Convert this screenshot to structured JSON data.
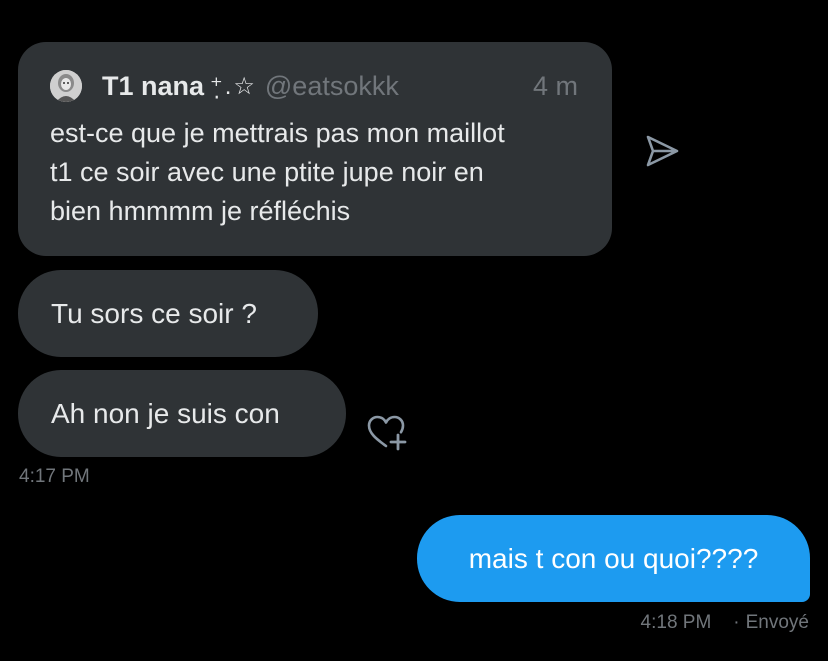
{
  "quoted_tweet": {
    "author_name": "T1 nana",
    "author_emoji": "⁺̣.☆",
    "handle": "@eatsokkk",
    "time": "4 m",
    "text": "est-ce que je mettrais pas mon maillot\nt1 ce soir avec une ptite jupe noir en\nbien hmmmm je réfléchis",
    "share_icon": "send-icon"
  },
  "messages": [
    {
      "text": "Tu sors ce soir ?",
      "direction": "received"
    },
    {
      "text": "Ah non je suis con",
      "direction": "received"
    }
  ],
  "received_time": "4:17 PM",
  "react_icon": "heart-plus-icon",
  "sent_message": {
    "text": "mais t con ou quoi????",
    "time": "4:18 PM",
    "status_sep": "·",
    "status": "Envoyé"
  },
  "colors": {
    "background": "#000000",
    "received_bubble": "#2F3336",
    "sent_bubble": "#1D9BF0",
    "muted_text": "#71767B",
    "primary_text": "#E7E9EA"
  }
}
